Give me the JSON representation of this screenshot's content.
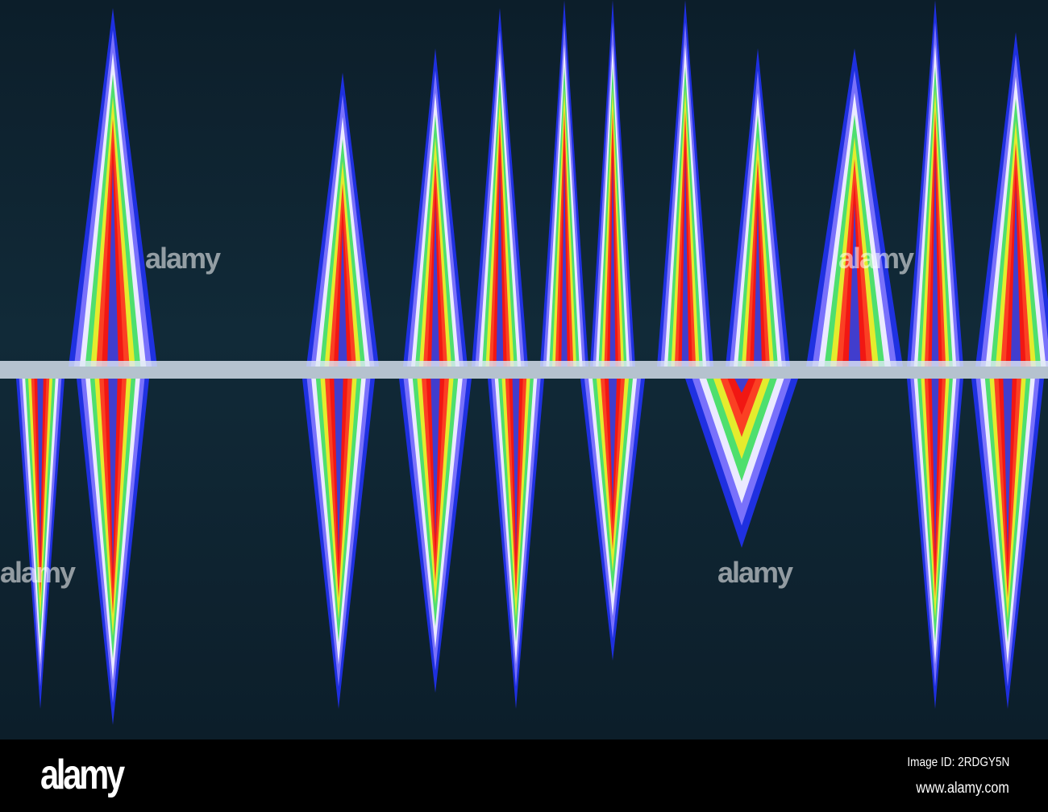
{
  "image": {
    "description_alt": "Abstract rainbow glitch pattern with mirrored triangular peaks",
    "watermark_text": "alamy"
  },
  "footer": {
    "logo": "alamy",
    "image_id": "Image ID: 2RDGY5N",
    "website": "www.alamy.com"
  }
}
